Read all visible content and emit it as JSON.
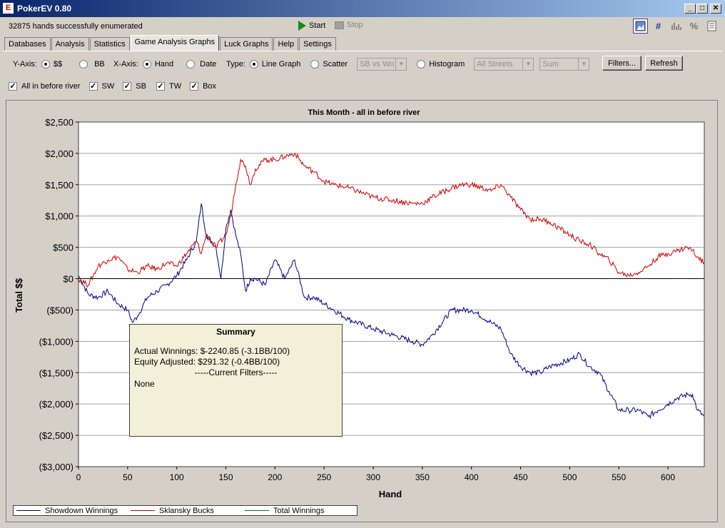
{
  "window": {
    "title": "PokerEV 0.80",
    "app_icon": "E"
  },
  "toolbar": {
    "status": "32875 hands successfully enumerated",
    "start_label": "Start",
    "stop_label": "Stop",
    "pct_icon": "%"
  },
  "tabs": [
    {
      "label": "Databases"
    },
    {
      "label": "Analysis"
    },
    {
      "label": "Statistics"
    },
    {
      "label": "Game Analysis Graphs",
      "active": true
    },
    {
      "label": "Luck Graphs"
    },
    {
      "label": "Help"
    },
    {
      "label": "Settings"
    }
  ],
  "options": {
    "yaxis_label": "Y-Axis:",
    "yaxis_dollars": "$$",
    "yaxis_bb": "BB",
    "xaxis_label": "X-Axis:",
    "xaxis_hand": "Hand",
    "xaxis_date": "Date",
    "type_label": "Type:",
    "type_line": "Line Graph",
    "type_scatter": "Scatter",
    "scatter_select": "SB vs Wo",
    "type_histogram": "Histogram",
    "streets_select": "All Streets",
    "sum_select": "Sum",
    "filters_button": "Filters...",
    "refresh_button": "Refresh"
  },
  "checkboxes": [
    {
      "label": "All in before river",
      "checked": true
    },
    {
      "label": "SW",
      "checked": true
    },
    {
      "label": "SB",
      "checked": true
    },
    {
      "label": "TW",
      "checked": true
    },
    {
      "label": "Box",
      "checked": true
    }
  ],
  "summary": {
    "heading": "Summary",
    "actual": "Actual Winnings: $-2240.85 (-3.1BB/100)",
    "equity": "Equity Adjusted: $291.32 (-0.4BB/100)",
    "filters_heading": "-----Current Filters-----",
    "filters_value": "None"
  },
  "chart_data": {
    "type": "line",
    "title": "This Month - all in before river",
    "xlabel": "Hand",
    "ylabel": "Total $$",
    "xlim": [
      0,
      637
    ],
    "ylim": [
      -3000,
      2500
    ],
    "xticks": [
      0,
      50,
      100,
      150,
      200,
      250,
      300,
      350,
      400,
      450,
      500,
      550,
      600
    ],
    "xtick_labels": [
      "0",
      "50",
      "100",
      "150",
      "200",
      "250",
      "300",
      "350",
      "400",
      "450",
      "500",
      "550",
      "600"
    ],
    "yticks": [
      2500,
      2000,
      1500,
      1000,
      500,
      0,
      -500,
      -1000,
      -1500,
      -2000,
      -2500,
      -3000
    ],
    "ytick_labels": [
      "$2,500",
      "$2,000",
      "$1,500",
      "$1,000",
      "$500",
      "$0",
      "($500)",
      "($1,000)",
      "($1,500)",
      "($2,000)",
      "($2,500)",
      "($3,000)"
    ],
    "grid": true,
    "legend_position": "bottom-left",
    "colors": {
      "sw": "#00008b",
      "sb": "#cc0000",
      "tw": "#008000"
    },
    "series": [
      {
        "name": "Showdown Winnings",
        "x": [
          0,
          10,
          20,
          30,
          40,
          50,
          55,
          60,
          70,
          80,
          90,
          100,
          110,
          120,
          125,
          130,
          140,
          145,
          150,
          155,
          160,
          165,
          170,
          175,
          180,
          190,
          200,
          210,
          220,
          230,
          240,
          250,
          260,
          275,
          300,
          320,
          340,
          350,
          360,
          380,
          390,
          400,
          420,
          430,
          440,
          450,
          460,
          470,
          480,
          500,
          510,
          520,
          530,
          540,
          550,
          560,
          570,
          580,
          590,
          600,
          610,
          620,
          625,
          630,
          637
        ],
        "values": [
          50,
          -250,
          -300,
          -200,
          -400,
          -500,
          -700,
          -600,
          -300,
          -200,
          -100,
          50,
          300,
          600,
          1200,
          700,
          500,
          0,
          800,
          1100,
          700,
          400,
          -200,
          0,
          0,
          -100,
          300,
          0,
          300,
          -300,
          -300,
          -400,
          -500,
          -650,
          -800,
          -900,
          -1000,
          -1050,
          -900,
          -500,
          -500,
          -500,
          -700,
          -800,
          -1200,
          -1400,
          -1500,
          -1500,
          -1400,
          -1300,
          -1200,
          -1400,
          -1500,
          -1800,
          -2100,
          -2100,
          -2100,
          -2200,
          -2100,
          -2000,
          -1900,
          -1850,
          -1850,
          -2100,
          -2200
        ]
      },
      {
        "name": "Sklansky Bucks",
        "x": [
          0,
          10,
          20,
          30,
          40,
          50,
          60,
          70,
          80,
          90,
          100,
          110,
          120,
          125,
          130,
          140,
          150,
          155,
          160,
          165,
          170,
          175,
          180,
          190,
          200,
          210,
          220,
          230,
          240,
          250,
          260,
          275,
          300,
          320,
          340,
          350,
          360,
          380,
          390,
          400,
          420,
          430,
          440,
          450,
          460,
          470,
          480,
          500,
          510,
          520,
          530,
          540,
          550,
          560,
          570,
          580,
          590,
          600,
          610,
          620,
          625,
          630,
          637
        ],
        "values": [
          0,
          -100,
          200,
          300,
          350,
          150,
          100,
          200,
          150,
          250,
          200,
          400,
          600,
          400,
          700,
          500,
          700,
          1000,
          1500,
          1900,
          1800,
          1500,
          1750,
          1900,
          1900,
          1950,
          2000,
          1800,
          1700,
          1550,
          1500,
          1450,
          1300,
          1250,
          1200,
          1200,
          1300,
          1450,
          1500,
          1500,
          1400,
          1500,
          1300,
          1100,
          950,
          950,
          900,
          700,
          600,
          550,
          400,
          300,
          100,
          50,
          100,
          200,
          350,
          400,
          450,
          500,
          450,
          350,
          250
        ]
      },
      {
        "name": "Total Winnings",
        "x": [],
        "values": []
      }
    ]
  }
}
